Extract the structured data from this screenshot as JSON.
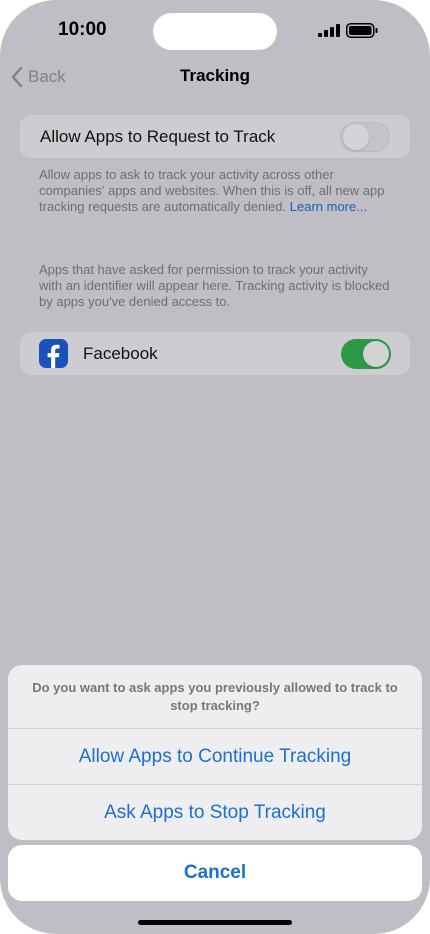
{
  "status_bar": {
    "time": "10:00",
    "icons": [
      "signal-icon",
      "battery-icon"
    ]
  },
  "nav": {
    "back_label": "Back",
    "title": "Tracking"
  },
  "allow_tracking": {
    "label": "Allow Apps to Request to Track",
    "enabled": false,
    "description": "Allow apps to ask to track your activity across other companies' apps and websites. When this is off, all new app tracking requests are automatically denied.",
    "learn_more": "Learn more..."
  },
  "apps_info": "Apps that have asked for permission to track your activity with an identifier will appear here. Tracking activity is blocked by apps you've denied access to.",
  "apps": [
    {
      "name": "Facebook",
      "icon": "facebook-icon",
      "enabled": true
    }
  ],
  "action_sheet": {
    "message": "Do you want to ask apps you previously allowed to track to stop tracking?",
    "buttons": [
      {
        "label": "Allow Apps to Continue Tracking"
      },
      {
        "label": "Ask Apps to Stop Tracking"
      }
    ],
    "cancel_label": "Cancel"
  },
  "colors": {
    "accent": "#1d6fd0",
    "toggle_on": "#2c9a45",
    "facebook": "#1a52b8"
  }
}
